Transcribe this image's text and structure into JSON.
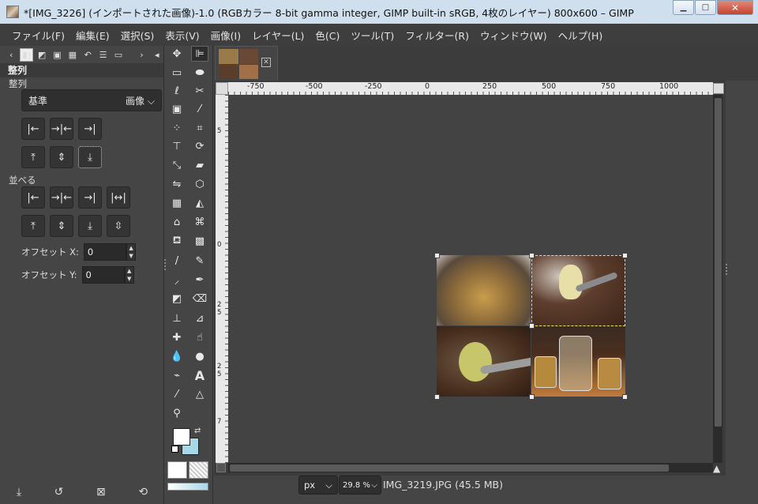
{
  "window": {
    "title": "*[IMG_3226] (インポートされた画像)-1.0 (RGBカラー 8-bit gamma integer, GIMP built-in sRGB, 4枚のレイヤー) 800x600 – GIMP",
    "buttons": [
      "minimize",
      "maximize",
      "close"
    ]
  },
  "menubar": {
    "items": [
      "ファイル(F)",
      "編集(E)",
      "選択(S)",
      "表示(V)",
      "画像(I)",
      "レイヤー(L)",
      "色(C)",
      "ツール(T)",
      "フィルター(R)",
      "ウィンドウ(W)",
      "ヘルプ(H)"
    ]
  },
  "dock": {
    "header": "整列",
    "subheader": "整列",
    "relative_to_label": "基準",
    "relative_to_value": "画像",
    "distribute_label": "並べる",
    "offset_x_label": "オフセット X:",
    "offset_x_value": "0",
    "offset_y_label": "オフセット Y:",
    "offset_y_value": "0"
  },
  "ruler": {
    "top_labels": [
      "-750",
      "-500",
      "-250",
      "0",
      "250",
      "500",
      "750",
      "1000"
    ],
    "left_labels": [
      "5",
      "0",
      "2",
      "5",
      "2",
      "5",
      "7"
    ]
  },
  "statusbar": {
    "unit": "px",
    "zoom": "29.8 %",
    "info": "IMG_3219.JPG (45.5 MB)"
  },
  "colors": {
    "foreground": "#ffffff",
    "background": "#a8d8e8",
    "selection": "#f5e34d"
  }
}
